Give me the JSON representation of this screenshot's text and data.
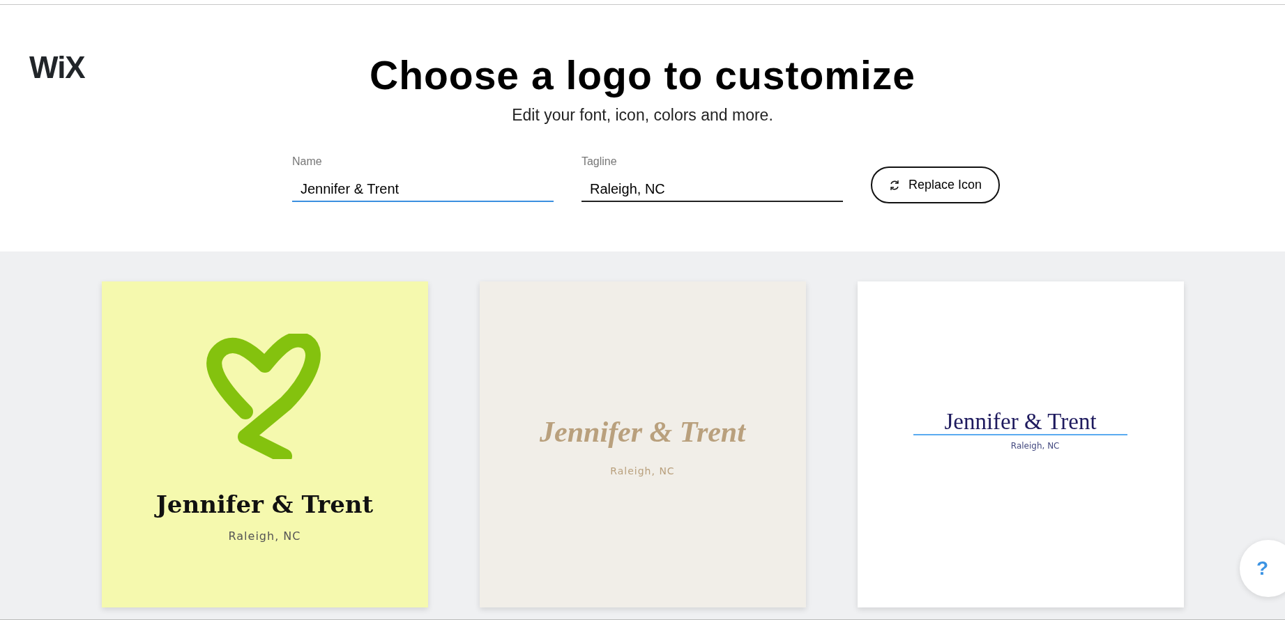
{
  "brand": {
    "logo": "WiX"
  },
  "header": {
    "title": "Choose a logo to customize",
    "subtitle": "Edit your font, icon, colors and more."
  },
  "fields": [
    {
      "label": "Name",
      "value": "Jennifer & Trent",
      "focused": true
    },
    {
      "label": "Tagline",
      "value": "Raleigh, NC",
      "focused": false
    }
  ],
  "replace_button": {
    "label": "Replace Icon"
  },
  "logos": [
    {
      "kind": "icon",
      "name": "Jennifer & Trent",
      "tagline": "Raleigh, NC"
    },
    {
      "kind": "script",
      "name": "Jennifer & Trent",
      "tagline": "Raleigh, NC"
    },
    {
      "kind": "underline",
      "name": "Jennifer & Trent",
      "tagline": "Raleigh, NC"
    }
  ],
  "help_button": {
    "label": "?"
  }
}
